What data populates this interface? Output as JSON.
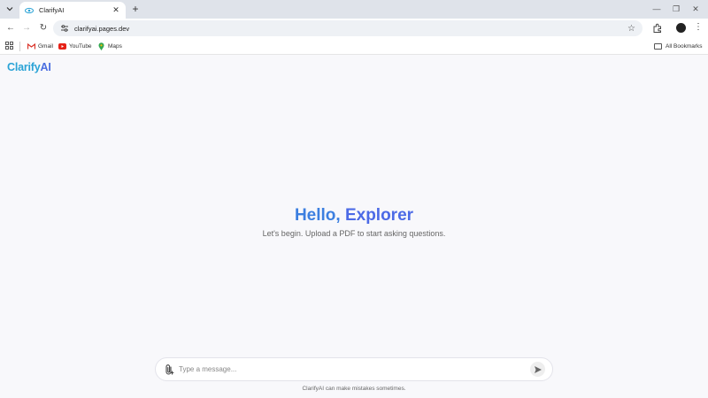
{
  "browser": {
    "tab_title": "ClarifyAI",
    "url": "clarifyai.pages.dev",
    "bookmarks": [
      {
        "label": "Gmail",
        "icon": "gmail-icon"
      },
      {
        "label": "YouTube",
        "icon": "youtube-icon"
      },
      {
        "label": "Maps",
        "icon": "maps-icon"
      }
    ],
    "all_bookmarks_label": "All Bookmarks"
  },
  "app": {
    "brand_prefix": "Clarify",
    "brand_suffix": "AI",
    "greeting_prefix": "Hello,",
    "greeting_name": "Explorer",
    "subtitle": "Let's begin. Upload a PDF to start asking questions.",
    "composer": {
      "placeholder": "Type a message..."
    },
    "disclaimer": "ClarifyAI can make mistakes sometimes."
  },
  "colors": {
    "brand_cyan": "#2aa3d6",
    "brand_blue": "#4a6ee0",
    "background": "#f8f8fb"
  }
}
